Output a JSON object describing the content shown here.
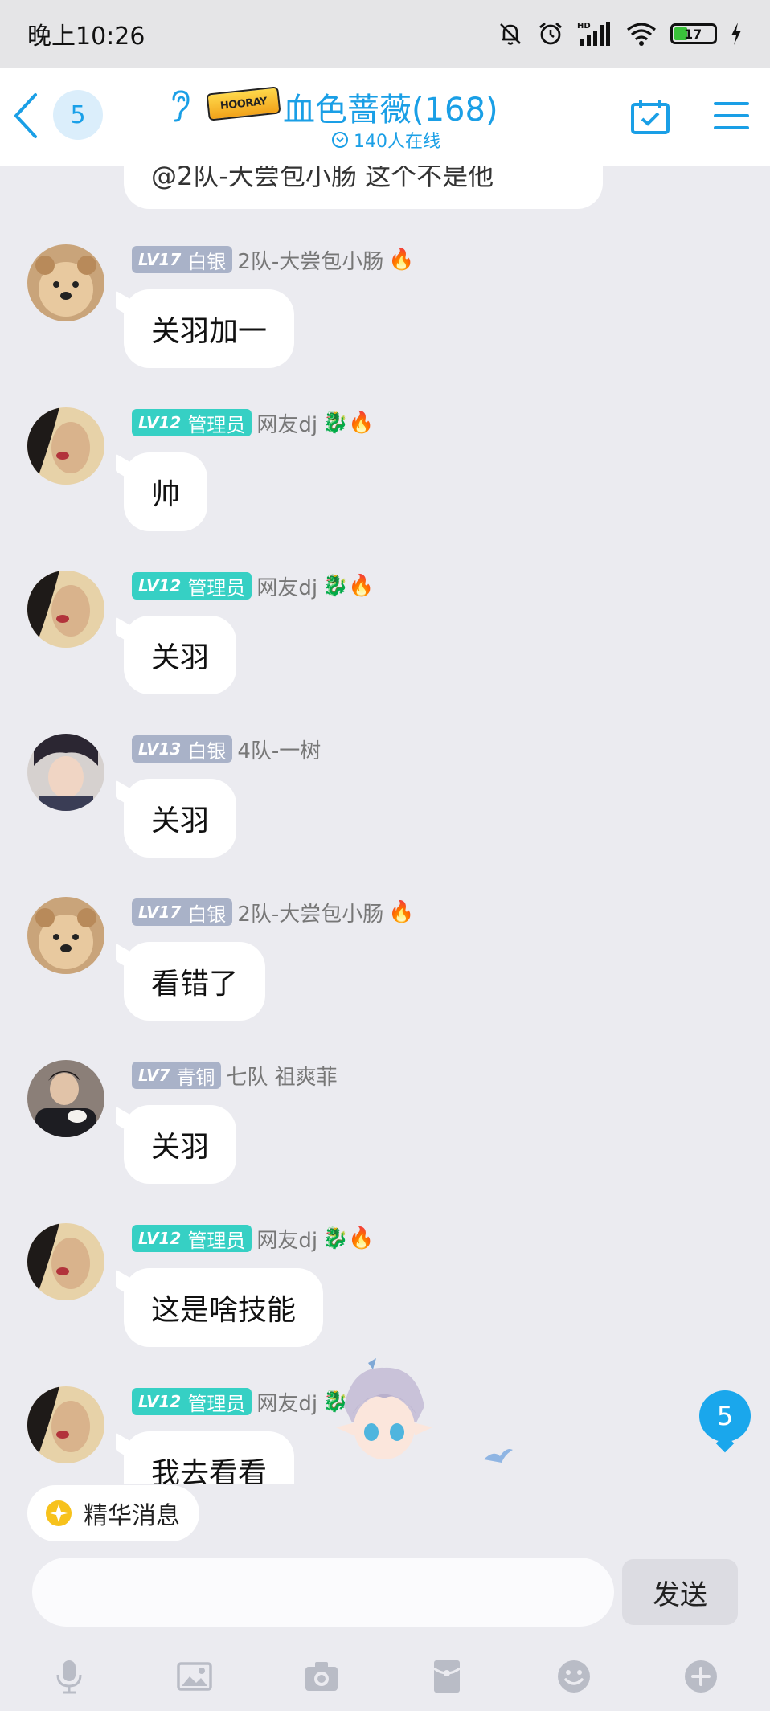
{
  "status_bar": {
    "time": "晚上10:26",
    "battery": "17",
    "hd_label": "HD"
  },
  "header": {
    "badge_count": "5",
    "logo_text": "HOORAY",
    "title": "血色蔷薇(168)",
    "online": "140人在线"
  },
  "top_partial_text": "@2队-大尝包小肠 这个不是他",
  "messages": [
    {
      "level": "LV17",
      "role": "白银",
      "nick": "2队-大尝包小肠",
      "badges": "🔥",
      "text": "关羽加一",
      "role_type": "silver"
    },
    {
      "level": "LV12",
      "role": "管理员",
      "nick": "网友dj",
      "badges": "🐉🔥",
      "text": "帅",
      "role_type": "admin"
    },
    {
      "level": "LV12",
      "role": "管理员",
      "nick": "网友dj",
      "badges": "🐉🔥",
      "text": "关羽",
      "role_type": "admin"
    },
    {
      "level": "LV13",
      "role": "白银",
      "nick": "4队-一树",
      "badges": "",
      "text": "关羽",
      "role_type": "silver"
    },
    {
      "level": "LV17",
      "role": "白银",
      "nick": "2队-大尝包小肠",
      "badges": "🔥",
      "text": "看错了",
      "role_type": "silver"
    },
    {
      "level": "LV7",
      "role": "青铜",
      "nick": "七队 祖爽菲",
      "badges": "",
      "text": "关羽",
      "role_type": "bronze"
    },
    {
      "level": "LV12",
      "role": "管理员",
      "nick": "网友dj",
      "badges": "🐉🔥",
      "text": "这是啥技能",
      "role_type": "admin"
    },
    {
      "level": "LV12",
      "role": "管理员",
      "nick": "网友dj",
      "badges": "🐉",
      "text": "我去看看",
      "role_type": "admin"
    }
  ],
  "float_unread": "5",
  "essence_label": "精华消息",
  "input": {
    "value": "",
    "placeholder": ""
  },
  "send_label": "发送",
  "colors": {
    "accent": "#1a9fe6",
    "admin": "#36d0c4",
    "silver": "#a9b2c8"
  }
}
